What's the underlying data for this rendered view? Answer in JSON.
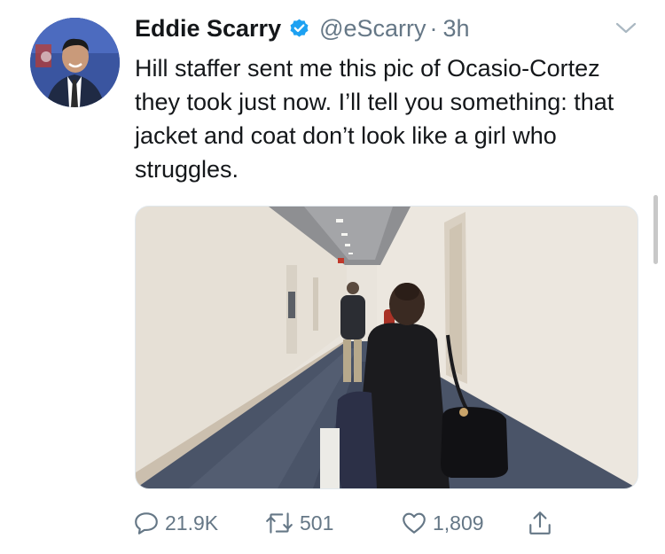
{
  "tweet": {
    "author": {
      "name": "Eddie Scarry",
      "handle": "@eScarry",
      "verified": true
    },
    "separator": "·",
    "time": "3h",
    "text": "Hill staffer sent me this pic of Ocasio-Cortez they took just now. I’ll tell you something: that jacket and coat don’t look like a girl who struggles.",
    "actions": {
      "reply_count": "21.9K",
      "retweet_count": "501",
      "like_count": "1,809"
    }
  },
  "icons": {
    "verified": "verified-badge-icon",
    "caret": "chevron-down-icon",
    "reply": "reply-icon",
    "retweet": "retweet-icon",
    "like": "heart-icon",
    "share": "share-icon"
  },
  "colors": {
    "text": "#14171a",
    "secondary": "#657786",
    "verified": "#1da1f2",
    "border": "#e1e8ed"
  }
}
